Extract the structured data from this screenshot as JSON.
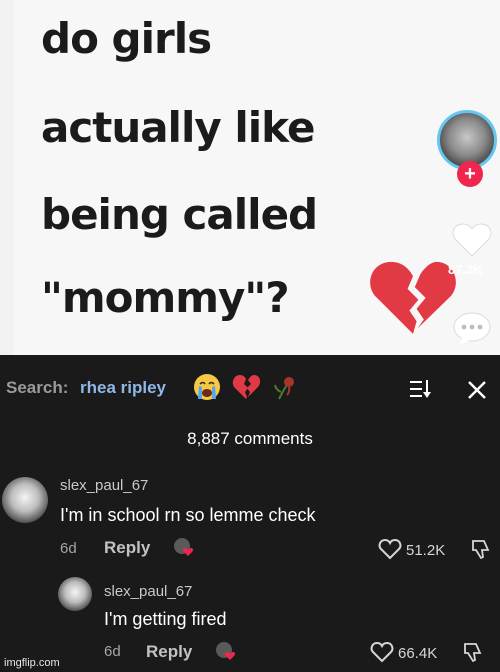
{
  "video": {
    "caption_lines": [
      "do girls",
      "actually like",
      "being called",
      "\"mommy\"?"
    ],
    "like_count": "87.3K",
    "colors": {
      "avatar_ring": "#63c7f0",
      "follow_plus": "#f0264f",
      "broken_heart": "#e23a45"
    }
  },
  "sheet": {
    "search_label": "Search:",
    "search_value": "rhea ripley",
    "search_emojis": [
      "loudly-crying-face",
      "broken-heart",
      "wilted-rose"
    ],
    "comment_count": "8,887 comments",
    "comments": [
      {
        "user": "slex_paul_67",
        "text": "I'm in school rn so lemme check",
        "age": "6d",
        "reply_label": "Reply",
        "likes": "51.2K"
      },
      {
        "user": "slex_paul_67",
        "text": "I'm getting fired",
        "age": "6d",
        "reply_label": "Reply",
        "likes": "66.4K"
      }
    ]
  },
  "watermark": "imgflip.com"
}
